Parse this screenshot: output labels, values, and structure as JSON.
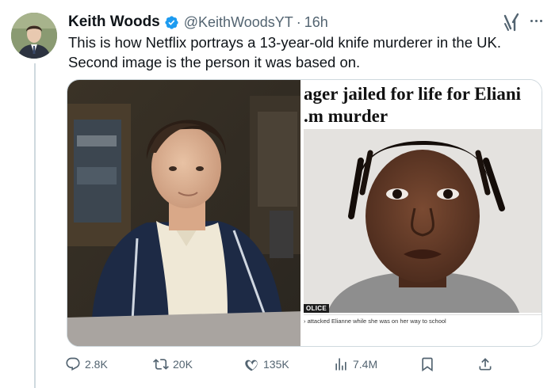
{
  "tweet": {
    "author_name": "Keith Woods",
    "author_handle": "@KeithWoodsYT",
    "separator": "·",
    "time": "16h",
    "text": "This is how Netflix portrays a 13-year-old knife murderer in the UK. Second image is the person it was based on."
  },
  "media": {
    "right": {
      "headline_line1": "ager jailed for life for Eliani",
      "headline_line2": ".m murder",
      "photo_tag": "OLICE",
      "caption": "› attacked Elianne while she was on her way to school"
    }
  },
  "actions": {
    "replies": "2.8K",
    "reposts": "20K",
    "likes": "135K",
    "views": "7.4M"
  },
  "colors": {
    "text_primary": "#0f1419",
    "text_secondary": "#536471",
    "verified_blue": "#1d9bf0",
    "border": "#cfd9de"
  },
  "icons": [
    "verified-badge-icon",
    "grok-icon",
    "more-icon",
    "reply-icon",
    "repost-icon",
    "like-icon",
    "views-icon",
    "bookmark-icon",
    "share-icon"
  ]
}
